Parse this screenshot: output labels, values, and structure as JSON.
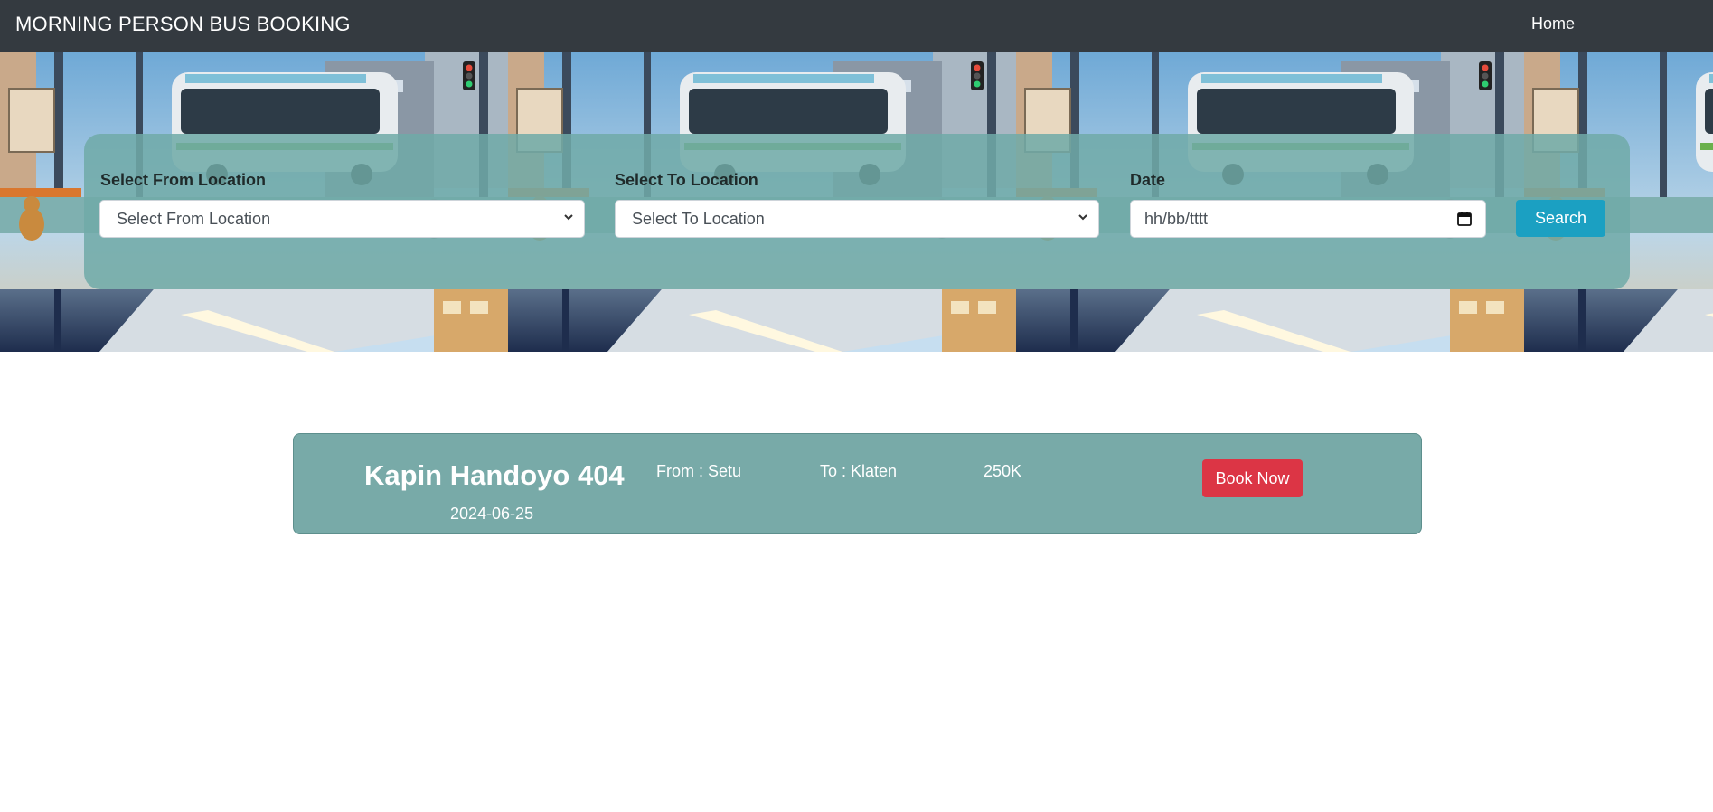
{
  "navbar": {
    "brand": "MORNING PERSON BUS BOOKING",
    "home_label": "Home"
  },
  "search": {
    "from_label": "Select From Location",
    "from_selected": "Select From Location",
    "to_label": "Select To Location",
    "to_selected": "Select To Location",
    "date_label": "Date",
    "date_placeholder": "hh/bb/tttt",
    "search_button": "Search"
  },
  "results": [
    {
      "bus_name": "Kapin Handoyo 404",
      "date": "2024-06-25",
      "from": "From : Setu",
      "to": "To : Klaten",
      "price": "250K",
      "book_label": "Book Now"
    }
  ],
  "colors": {
    "navbar_bg": "#343a40",
    "panel_bg": "#70aaa8",
    "search_button": "#1ba0c2",
    "card_bg": "#78aaa8",
    "book_button": "#dc3545"
  },
  "icons": {
    "select_chevron": "chevron-down-icon",
    "date_picker": "calendar-icon"
  }
}
